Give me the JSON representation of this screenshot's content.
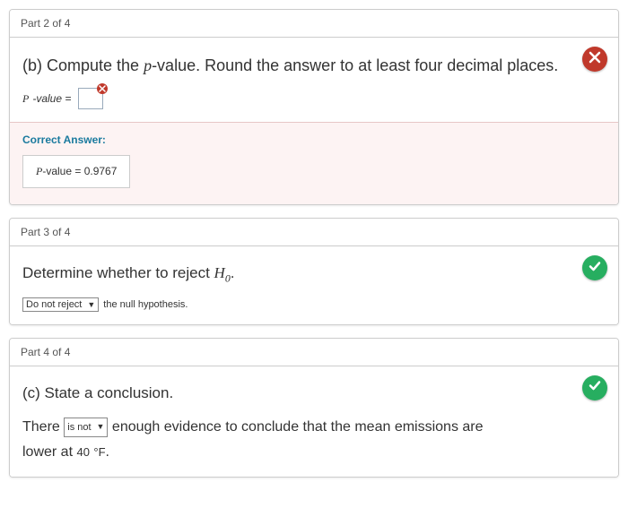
{
  "part2": {
    "header": "Part 2 of 4",
    "status": "wrong",
    "prompt_pre": "(b) Compute the ",
    "prompt_var": "p",
    "prompt_post": "-value. Round the answer to at least four decimal places.",
    "label_pre": "P",
    "label_post": "-value =",
    "correct": {
      "title": "Correct Answer:",
      "value_pre": "P",
      "value_mid": "-value = ",
      "value_num": "0.9767"
    }
  },
  "part3": {
    "header": "Part 3 of 4",
    "status": "correct",
    "prompt_pre": "Determine whether to reject ",
    "prompt_var": "H",
    "prompt_sub": "0",
    "prompt_post": ".",
    "select_value": "Do not reject",
    "after": "the null hypothesis."
  },
  "part4": {
    "header": "Part 4 of 4",
    "status": "correct",
    "prompt": "(c) State a conclusion.",
    "sentence_pre": "There",
    "select_value": "is not",
    "sentence_mid": "enough evidence to conclude that the mean emissions are",
    "sentence_post_pre": "lower at",
    "temp_number": "40",
    "temp_unit": "°F",
    "sentence_end": "."
  }
}
